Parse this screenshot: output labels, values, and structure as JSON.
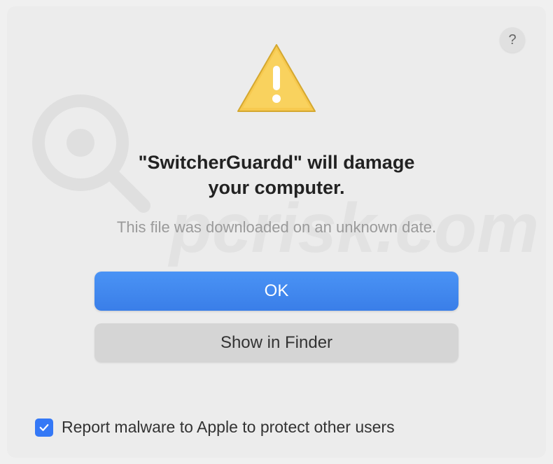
{
  "dialog": {
    "help_label": "?",
    "title_line1": "\"SwitcherGuardd\" will damage",
    "title_line2": "your computer.",
    "subtitle": "This file was downloaded on an unknown date.",
    "ok_label": "OK",
    "show_finder_label": "Show in Finder",
    "checkbox_label": "Report malware to Apple to protect other users",
    "checkbox_checked": true
  },
  "watermark": {
    "text": "pcrisk.com"
  }
}
